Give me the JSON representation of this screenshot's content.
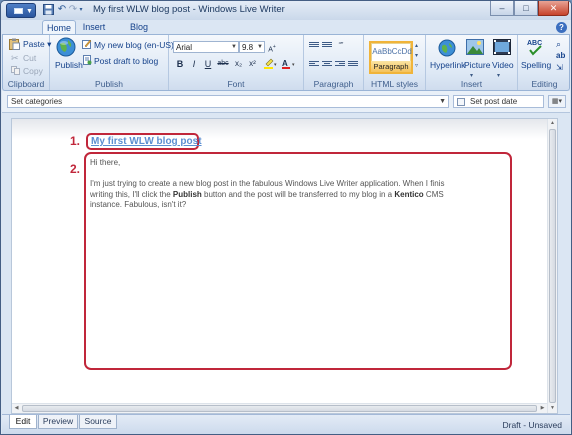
{
  "window": {
    "title": "My first WLW blog post - Windows Live Writer",
    "controls": {
      "minimize": "–",
      "maximize": "□",
      "close": "✕"
    }
  },
  "quick_access": {
    "icons": [
      "save-icon",
      "undo-icon",
      "redo-icon",
      "customize-icon"
    ]
  },
  "ribbon_tabs": [
    {
      "label": "Home",
      "active": true
    },
    {
      "label": "Insert",
      "active": false
    },
    {
      "label": "Blog Account",
      "active": false
    }
  ],
  "clipboard": {
    "paste": "Paste",
    "cut": "Cut",
    "copy": "Copy",
    "group": "Clipboard"
  },
  "publish": {
    "publish": "Publish",
    "blog": "My new blog (en-US)",
    "draft": "Post draft to blog",
    "group": "Publish"
  },
  "font": {
    "family": "Arial",
    "size": "9.8",
    "buttons": [
      "B",
      "I",
      "U",
      "abc",
      "x₂",
      "x²"
    ],
    "group": "Font"
  },
  "paragraph": {
    "group": "Paragraph"
  },
  "html_styles": {
    "sample": "AaBbCcDd",
    "style": "Paragraph",
    "group": "HTML styles"
  },
  "insert": {
    "hyperlink": "Hyperlink",
    "picture": "Picture",
    "video": "Video",
    "group": "Insert"
  },
  "editing": {
    "spelling": "Spelling",
    "group": "Editing"
  },
  "category_bar": {
    "placeholder": "Set categories",
    "set_post_date": "Set post date"
  },
  "post": {
    "title": "My first WLW blog post",
    "greeting": "Hi there,",
    "body_1": "I'm just trying to create a new blog post in the fabulous Windows Live Writer application. When I finis writing this, I'll click the ",
    "bold_publish": "Publish",
    "body_2": " button and the post will be transferred to my blog in a ",
    "bold_kentico": "Kentico",
    "body_3": " CMS instance. Fabulous, isn't it?"
  },
  "markers": {
    "first": "1.",
    "second": "2."
  },
  "view_tabs": [
    {
      "label": "Edit",
      "active": true
    },
    {
      "label": "Preview",
      "active": false
    },
    {
      "label": "Source",
      "active": false
    }
  ],
  "status": "Draft - Unsaved",
  "colors": {
    "frame_red": "#c0263a",
    "title_blue": "#5b8ed1",
    "ribbon_text": "#15428b"
  }
}
